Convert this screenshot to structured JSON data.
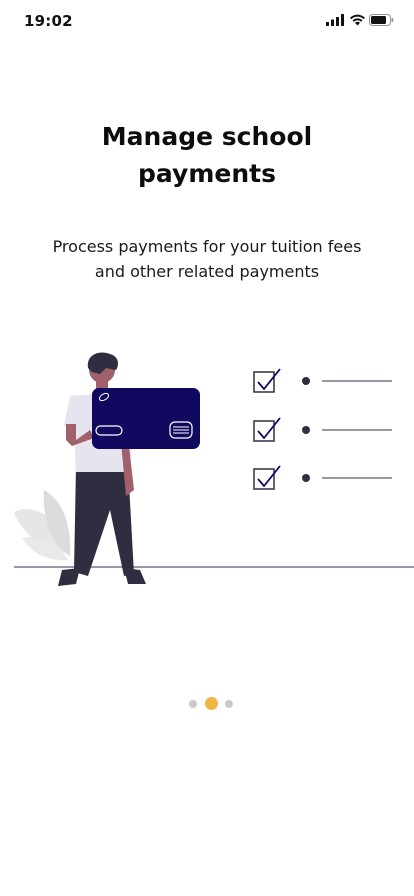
{
  "status_bar": {
    "time": "19:02"
  },
  "onboarding": {
    "title_line1": "Manage school",
    "title_line2": "payments",
    "subtitle_line1": "Process payments for your tuition fees",
    "subtitle_line2": "and other related payments"
  },
  "pagination": {
    "total_pages": 3,
    "active_page": 2
  },
  "colors": {
    "card": "#10095f",
    "accent_dot": "#f2b544",
    "inactive_dot": "#c9c9c9",
    "check_color": "#2f2e41"
  }
}
